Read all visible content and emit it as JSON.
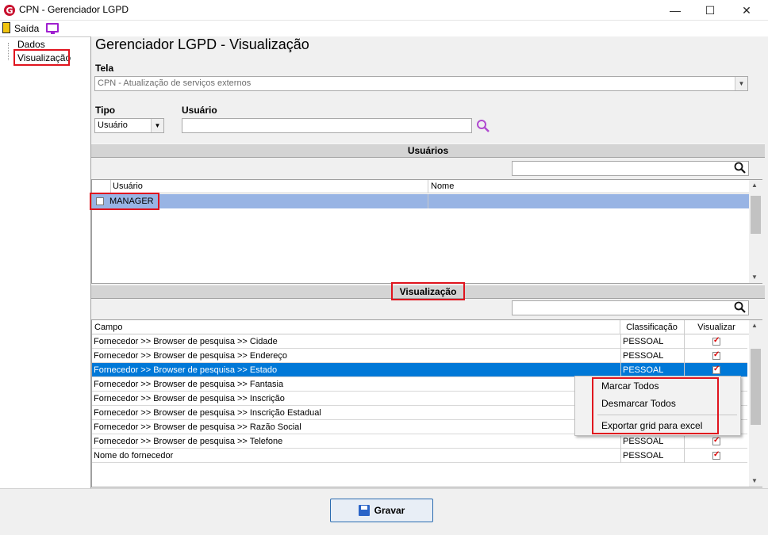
{
  "window": {
    "title": "CPN - Gerenciador LGPD",
    "minimize": "—",
    "maximize": "☐",
    "close": "✕"
  },
  "menu": {
    "exit_label": "Saída"
  },
  "nav": {
    "items": [
      "Dados",
      "Visualização"
    ]
  },
  "page_title": "Gerenciador LGPD - Visualização",
  "tela": {
    "label": "Tela",
    "value": "CPN - Atualização de serviços externos"
  },
  "tipo": {
    "label": "Tipo",
    "value": "Usuário"
  },
  "usuario": {
    "label": "Usuário",
    "value": ""
  },
  "users_section": {
    "header": "Usuários",
    "columns": [
      "Usuário",
      "Nome"
    ],
    "rows": [
      {
        "usuario": "MANAGER",
        "nome": "",
        "checked": false
      }
    ]
  },
  "view_section": {
    "header": "Visualização",
    "columns": [
      "Campo",
      "Classificação",
      "Visualizar"
    ],
    "rows": [
      {
        "campo": "Fornecedor >> Browser de pesquisa >> Cidade",
        "classificacao": "PESSOAL",
        "visualizar": true
      },
      {
        "campo": "Fornecedor >> Browser de pesquisa >> Endereço",
        "classificacao": "PESSOAL",
        "visualizar": true
      },
      {
        "campo": "Fornecedor >> Browser de pesquisa >> Estado",
        "classificacao": "PESSOAL",
        "visualizar": true,
        "selected": true
      },
      {
        "campo": "Fornecedor >> Browser de pesquisa >> Fantasia",
        "classificacao": "",
        "visualizar": true
      },
      {
        "campo": "Fornecedor >> Browser de pesquisa >> Inscrição",
        "classificacao": "",
        "visualizar": true
      },
      {
        "campo": "Fornecedor >> Browser de pesquisa >> Inscrição Estadual",
        "classificacao": "",
        "visualizar": true
      },
      {
        "campo": "Fornecedor >> Browser de pesquisa >> Razão Social",
        "classificacao": "",
        "visualizar": true
      },
      {
        "campo": "Fornecedor >> Browser de pesquisa >> Telefone",
        "classificacao": "PESSOAL",
        "visualizar": true
      },
      {
        "campo": "Nome do fornecedor",
        "classificacao": "PESSOAL",
        "visualizar": true
      }
    ]
  },
  "context_menu": {
    "items": [
      "Marcar Todos",
      "Desmarcar Todos",
      "Exportar grid para excel"
    ]
  },
  "save_button": {
    "label": "Gravar"
  },
  "colors": {
    "selection": "#0078d7",
    "highlight_row": "#98b4e4",
    "annotation_red": "#e0141e"
  }
}
